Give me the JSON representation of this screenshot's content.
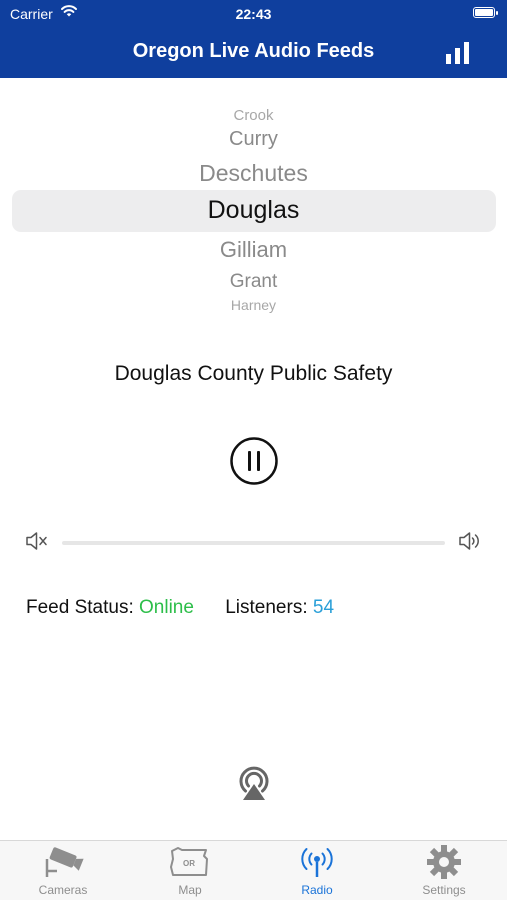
{
  "status_bar": {
    "carrier": "Carrier",
    "time": "22:43"
  },
  "header": {
    "title": "Oregon Live Audio Feeds",
    "stats_icon": "bar-chart-icon"
  },
  "picker": {
    "items_above": [
      "Crook",
      "Curry",
      "Deschutes"
    ],
    "selected": "Douglas",
    "items_below": [
      "Gilliam",
      "Grant",
      "Harney"
    ]
  },
  "player": {
    "feed_name": "Douglas County Public Safety",
    "play_state": "playing",
    "volume_level": 0
  },
  "status": {
    "feed_status_label": "Feed Status:",
    "feed_status_value": "Online",
    "listeners_label": "Listeners:",
    "listeners_value": "54"
  },
  "tabs": [
    {
      "label": "Cameras",
      "icon": "camera-icon"
    },
    {
      "label": "Map",
      "icon": "oregon-map-icon"
    },
    {
      "label": "Radio",
      "icon": "radio-antenna-icon"
    },
    {
      "label": "Settings",
      "icon": "gear-icon"
    }
  ],
  "colors": {
    "header_bg": "#0f3f9e",
    "online": "#2dbe4a",
    "listeners": "#2a9fd8",
    "active_tab": "#1a73d8"
  }
}
